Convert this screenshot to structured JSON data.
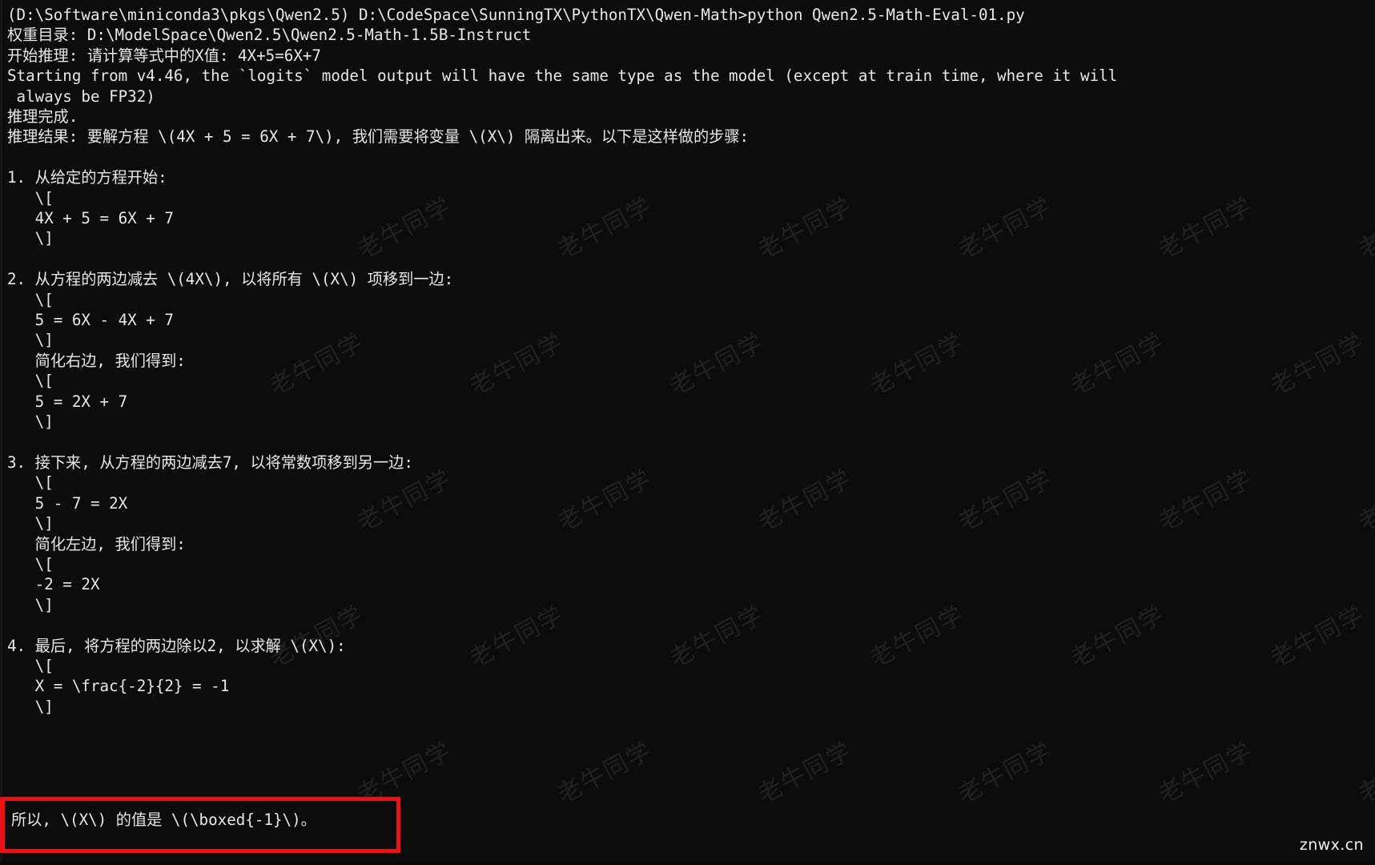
{
  "window": {
    "background_color": "#0c0c0c",
    "text_color": "#e8e8e8",
    "highlight_color": "#ee1111"
  },
  "watermark": {
    "repeated_text": "老牛同学",
    "site": "znwx.cn"
  },
  "console": {
    "lines": [
      "(D:\\Software\\miniconda3\\pkgs\\Qwen2.5) D:\\CodeSpace\\SunningTX\\PythonTX\\Qwen-Math>python Qwen2.5-Math-Eval-01.py",
      "权重目录: D:\\ModelSpace\\Qwen2.5\\Qwen2.5-Math-1.5B-Instruct",
      "开始推理: 请计算等式中的X值: 4X+5=6X+7",
      "Starting from v4.46, the `logits` model output will have the same type as the model (except at train time, where it will",
      " always be FP32)",
      "推理完成.",
      "推理结果: 要解方程 \\(4X + 5 = 6X + 7\\), 我们需要将变量 \\(X\\) 隔离出来。以下是这样做的步骤:",
      "",
      "1. 从给定的方程开始:",
      "   \\[",
      "   4X + 5 = 6X + 7",
      "   \\]",
      "",
      "2. 从方程的两边减去 \\(4X\\), 以将所有 \\(X\\) 项移到一边:",
      "   \\[",
      "   5 = 6X - 4X + 7",
      "   \\]",
      "   简化右边, 我们得到:",
      "   \\[",
      "   5 = 2X + 7",
      "   \\]",
      "",
      "3. 接下来, 从方程的两边减去7, 以将常数项移到另一边:",
      "   \\[",
      "   5 - 7 = 2X",
      "   \\]",
      "   简化左边, 我们得到:",
      "   \\[",
      "   -2 = 2X",
      "   \\]",
      "",
      "4. 最后, 将方程的两边除以2, 以求解 \\(X\\):",
      "   \\[",
      "   X = \\frac{-2}{2} = -1",
      "   \\]",
      ""
    ]
  },
  "answer": {
    "text": "所以, \\(X\\) 的值是 \\(\\boxed{-1}\\)。",
    "value": "-1"
  }
}
